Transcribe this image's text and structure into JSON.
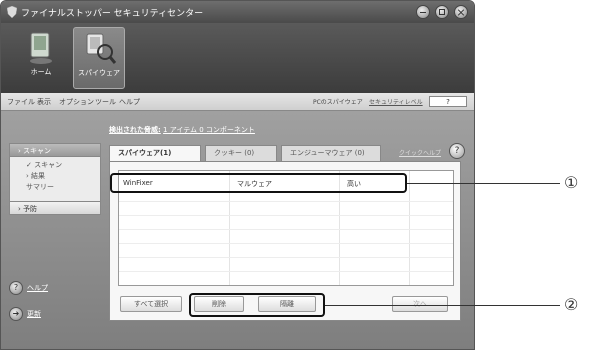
{
  "titlebar": {
    "title": "ファイナルストッパー セキュリティセンター"
  },
  "nav": {
    "home_label": "ホーム",
    "spyware_label": "スパイウェア"
  },
  "menu": {
    "items": [
      "ファイル",
      "表示",
      "オプション",
      "ツール",
      "ヘルプ"
    ],
    "right_text": "PCのスパイウェア",
    "level_link": "セキュリティレベル",
    "level_value": "?"
  },
  "detected": {
    "label": "検出された脅威:",
    "value": "1 アイテム 0 コンポーネント"
  },
  "sidebar": {
    "scan": "スキャン",
    "sub_items": [
      "✓ スキャン",
      "› 結果",
      "サマリー"
    ],
    "schedule": "予防",
    "help": "ヘルプ",
    "update": "更新"
  },
  "tabs": [
    {
      "label": "スパイウェア(1)"
    },
    {
      "label": "クッキー (0)"
    },
    {
      "label": "エンジューマウェア (0)"
    }
  ],
  "quick_help": "クイックヘルプ",
  "help_icon_glyph": "?",
  "list": {
    "rows": [
      {
        "name": "WinFixer",
        "type": "マルウェア",
        "risk": "高い"
      }
    ]
  },
  "buttons": {
    "select_all": "すべて選択",
    "delete": "削除",
    "quarantine": "隔離",
    "next": "次へ"
  },
  "callouts": {
    "one": "①",
    "two": "②"
  }
}
